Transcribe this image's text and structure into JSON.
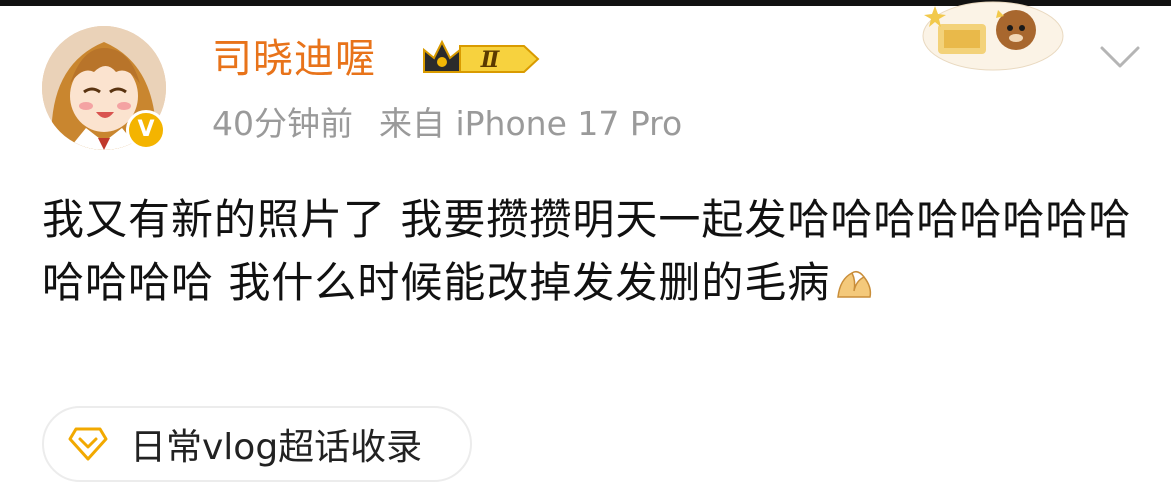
{
  "post": {
    "username": "司晓迪喔",
    "vip_level": "Ⅱ",
    "time": "40分钟前",
    "source": "来自 iPhone 17 Pro",
    "text": "我又有新的照片了 我要攒攒明天一起发哈哈哈哈哈哈哈哈哈哈哈哈 我什么时候能改掉发发删的毛病",
    "topic": "日常vlog超话收录"
  },
  "icons": {
    "verified": "verified-v-icon",
    "crown": "crown-icon",
    "menu": "chevron-down-icon",
    "emoji": "pinched-fingers-emoji",
    "topic": "diamond-topic-icon"
  },
  "colors": {
    "username": "#e8731a",
    "meta": "#9a9a9a",
    "verified": "#f4b400",
    "vip_gold": "#f2b705"
  }
}
